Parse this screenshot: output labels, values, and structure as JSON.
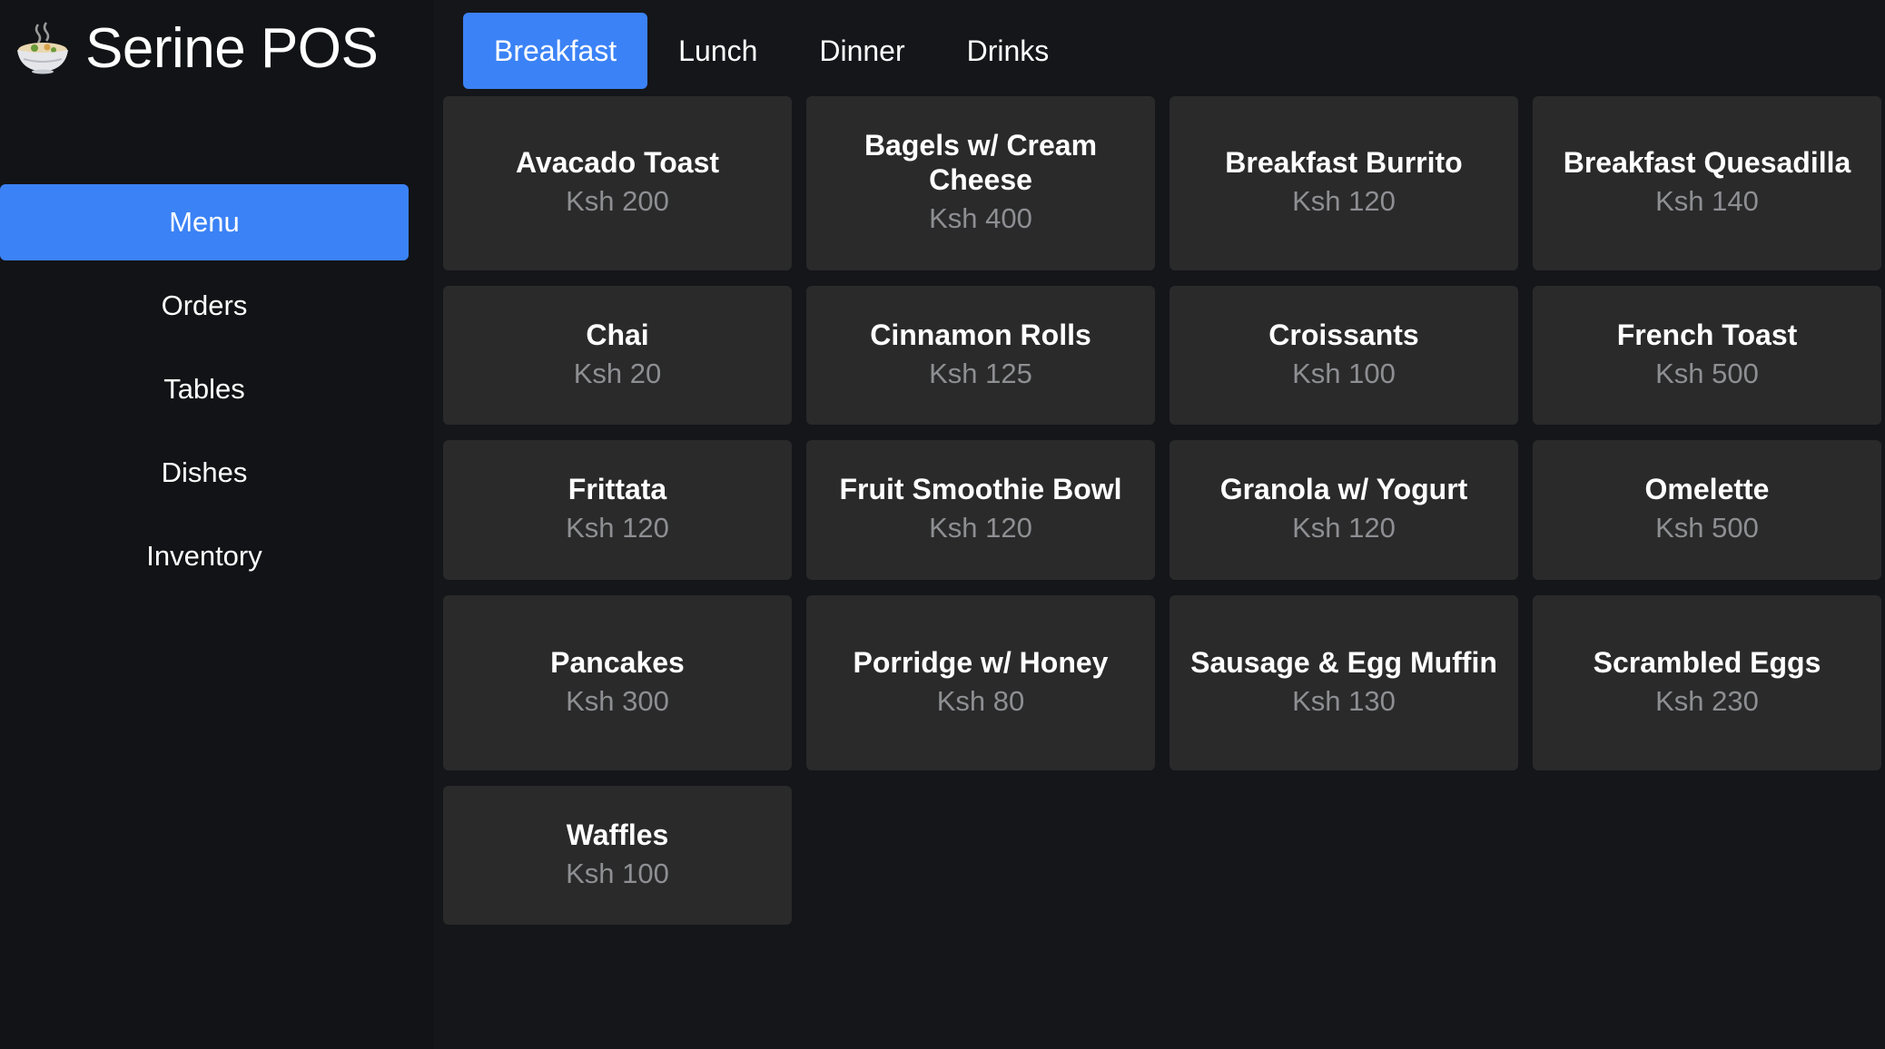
{
  "app": {
    "title": "Serine POS",
    "logo_icon": "noodle-bowl-icon"
  },
  "sidebar": {
    "items": [
      {
        "label": "Menu",
        "active": true
      },
      {
        "label": "Orders",
        "active": false
      },
      {
        "label": "Tables",
        "active": false
      },
      {
        "label": "Dishes",
        "active": false
      },
      {
        "label": "Inventory",
        "active": false
      }
    ]
  },
  "tabs": [
    {
      "label": "Breakfast",
      "active": true
    },
    {
      "label": "Lunch",
      "active": false
    },
    {
      "label": "Dinner",
      "active": false
    },
    {
      "label": "Drinks",
      "active": false
    }
  ],
  "menu_items": [
    {
      "name": "Avacado Toast",
      "price": "Ksh 200"
    },
    {
      "name": "Bagels w/ Cream Cheese",
      "price": "Ksh 400"
    },
    {
      "name": "Breakfast Burrito",
      "price": "Ksh 120"
    },
    {
      "name": "Breakfast Quesadilla",
      "price": "Ksh 140"
    },
    {
      "name": "Chai",
      "price": "Ksh 20"
    },
    {
      "name": "Cinnamon Rolls",
      "price": "Ksh 125"
    },
    {
      "name": "Croissants",
      "price": "Ksh 100"
    },
    {
      "name": "French Toast",
      "price": "Ksh 500"
    },
    {
      "name": "Frittata",
      "price": "Ksh 120"
    },
    {
      "name": "Fruit Smoothie Bowl",
      "price": "Ksh 120"
    },
    {
      "name": "Granola w/ Yogurt",
      "price": "Ksh 120"
    },
    {
      "name": "Omelette",
      "price": "Ksh 500"
    },
    {
      "name": "Pancakes",
      "price": "Ksh 300"
    },
    {
      "name": "Porridge w/ Honey",
      "price": "Ksh 80"
    },
    {
      "name": "Sausage & Egg Muffin",
      "price": "Ksh 130"
    },
    {
      "name": "Scrambled Eggs",
      "price": "Ksh 230"
    },
    {
      "name": "Waffles",
      "price": "Ksh 100"
    }
  ],
  "colors": {
    "accent": "#3b82f6",
    "background": "#121316",
    "card": "#2a2a2b",
    "price_text": "#8e8f92"
  }
}
